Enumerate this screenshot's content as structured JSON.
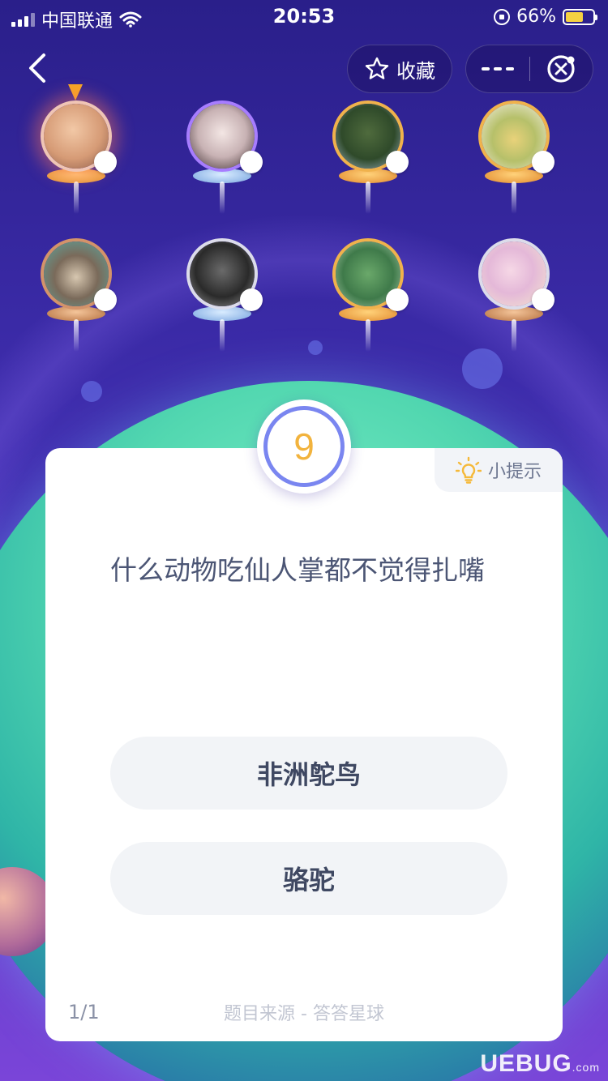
{
  "status_bar": {
    "carrier": "中国联通",
    "time": "20:53",
    "battery": "66%",
    "battery_level": 0.66,
    "icons": [
      "signal-icon",
      "wifi-icon",
      "rotation-lock-icon",
      "battery-icon"
    ]
  },
  "nav": {
    "back_icon": "chevron-left-icon",
    "favorite_label": "收藏",
    "favorite_icon": "star-outline-icon",
    "more_icon": "more-icon",
    "exit_icon": "exit-game-icon"
  },
  "players": [
    {
      "ring": "me",
      "avatar": "child-photo",
      "pedestal": "gold"
    },
    {
      "ring": "purple",
      "avatar": "woman-photo",
      "pedestal": "blue"
    },
    {
      "ring": "gold",
      "avatar": "tree-photo",
      "pedestal": "gold"
    },
    {
      "ring": "gold",
      "avatar": "tiger-cartoon",
      "pedestal": "gold"
    },
    {
      "ring": "bronze",
      "avatar": "pug-photo",
      "pedestal": "bronze"
    },
    {
      "ring": "silver",
      "avatar": "soldier-photo",
      "pedestal": "blue"
    },
    {
      "ring": "gold",
      "avatar": "clover-photo",
      "pedestal": "gold"
    },
    {
      "ring": "silver",
      "avatar": "flowers-photo",
      "pedestal": "bronze"
    }
  ],
  "question": {
    "countdown": "9",
    "hint_label": "小提示",
    "hint_icon": "lightbulb-icon",
    "text": "什么动物吃仙人掌都不觉得扎嘴",
    "options": [
      "非洲鸵鸟",
      "骆驼"
    ],
    "progress": "1/1",
    "source": "题目来源 - 答答星球"
  },
  "colors": {
    "bg_top": "#2a1f8a",
    "bg_bottom": "#7a45d8",
    "accent_ring": "#7a86f0",
    "countdown": "#f2b33d",
    "hint_bulb": "#f5b93a"
  },
  "watermark": {
    "main": "UEBUG",
    "suffix": ".com"
  }
}
